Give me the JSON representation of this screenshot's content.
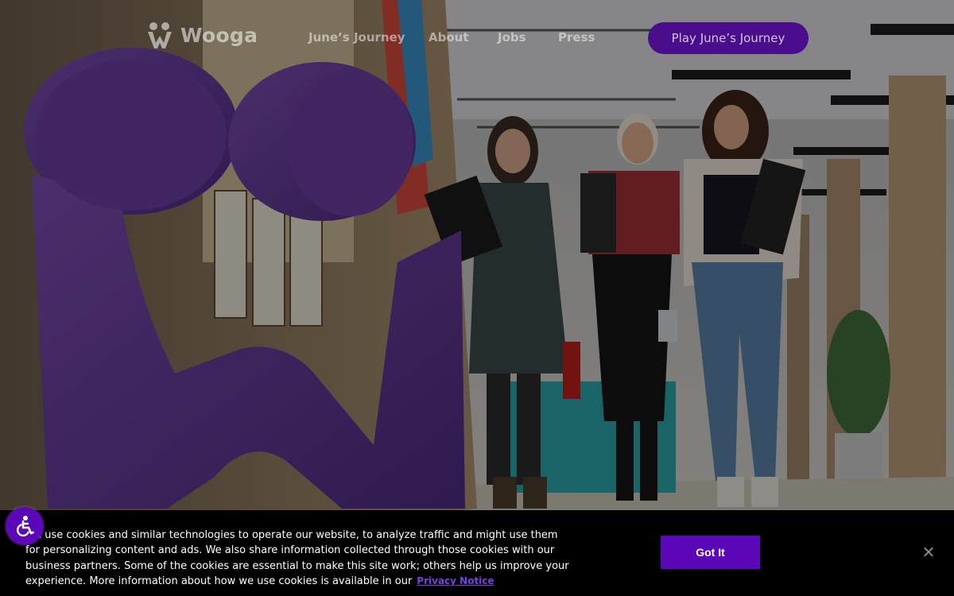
{
  "header": {
    "logo_text": "Wooga",
    "nav": {
      "junes_journey": "June’s Journey",
      "about": "About",
      "jobs": "Jobs",
      "press": "Press"
    },
    "cta_label": "Play June’s Journey"
  },
  "cookie_banner": {
    "text": "We use cookies and similar technologies to operate our website, to analyze traffic and might use them for personalizing content and ads. We also share information collected through those cookies with our business partners. Some of the cookies are essential to make this site work; others help us improve your experience. More information about how we use cookies is available in our",
    "privacy_link": "Privacy Notice",
    "accept_label": "Got It",
    "close_label": "×"
  },
  "icons": {
    "logo": "wooga-logo-icon",
    "accessibility": "accessibility-icon",
    "close": "close-icon"
  },
  "colors": {
    "brand_purple": "#5b09b8",
    "cta_purple": "#4a0d8c",
    "banner_bg": "#000000"
  }
}
